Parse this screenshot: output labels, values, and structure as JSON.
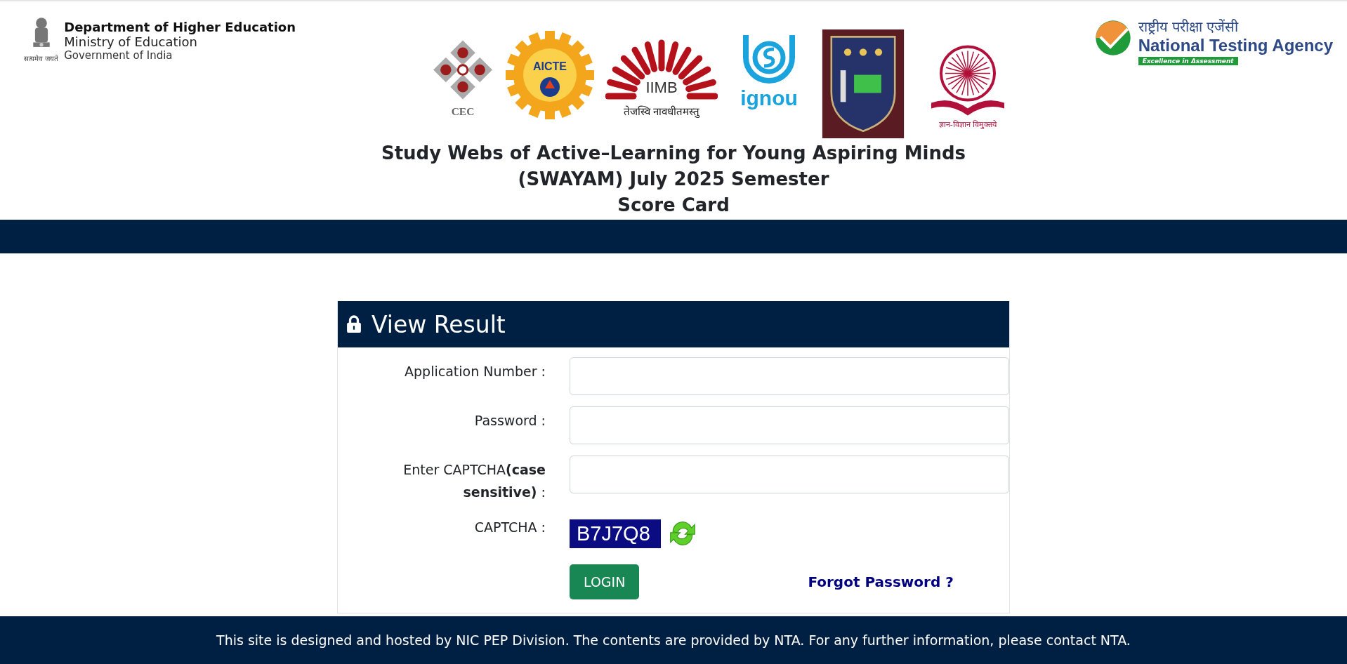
{
  "header": {
    "motto": "सत्यमेव जयते",
    "department": "Department of Higher Education",
    "ministry": "Ministry of Education",
    "government": "Government of India"
  },
  "partner_logos": [
    {
      "kind": "petals",
      "caption": "CEC"
    },
    {
      "kind": "gear",
      "caption": "AICTE"
    },
    {
      "kind": "sunburst",
      "caption": "IIMB",
      "motto": "तेजस्वि नावधीतमस्तु"
    },
    {
      "kind": "ring",
      "caption": "ignou"
    },
    {
      "kind": "crest"
    },
    {
      "kind": "wheel",
      "motto": "ज्ञान-विज्ञान विमुक्तये"
    }
  ],
  "agency": {
    "hindi_name": "राष्ट्रीय परीक्षा एजेंसी",
    "name": "National Testing Agency",
    "tagline": "Excellence in Assessment"
  },
  "title_lines": [
    "Study Webs of Active–Learning for Young Aspiring Minds",
    "(SWAYAM) July 2025 Semester",
    "Score Card"
  ],
  "form": {
    "title": "View Result",
    "fields": [
      {
        "label": "Application Number :"
      },
      {
        "label": "Password :"
      },
      {
        "label": "Enter CAPTCHA**(case sensitive)** :"
      }
    ],
    "captcha_label": "CAPTCHA :",
    "captcha_code": "B7J7Q8",
    "login_button": "LOGIN",
    "forgot_link": "Forgot Password ?"
  },
  "footer": "This site is designed and hosted by NIC PEP Division. The contents are provided by NTA. For any further information, please contact NTA."
}
